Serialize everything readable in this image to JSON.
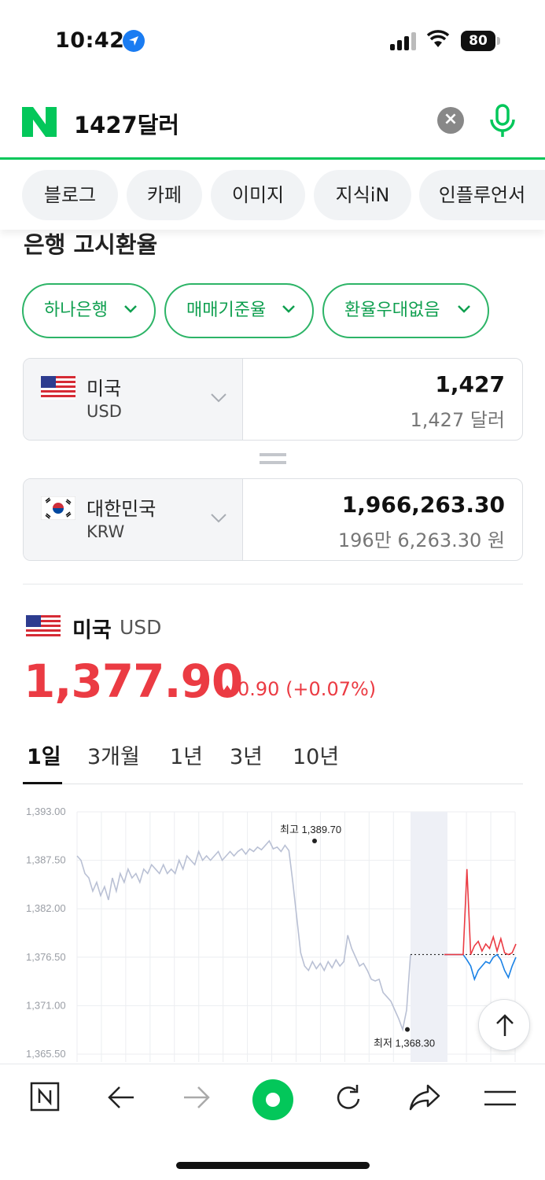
{
  "status": {
    "time": "10:42",
    "battery": "80"
  },
  "search": {
    "query": "1427달러"
  },
  "tabs": [
    "블로그",
    "카페",
    "이미지",
    "지식iN",
    "인플루언서"
  ],
  "section": {
    "title": "은행 고시환율",
    "chips": [
      "하나은행",
      "매매기준율",
      "환율우대없음"
    ]
  },
  "converter": {
    "from": {
      "name": "미국",
      "code": "USD",
      "amount": "1,427",
      "amount_text": "1,427 달러"
    },
    "to": {
      "name": "대한민국",
      "code": "KRW",
      "amount": "1,966,263.30",
      "amount_text": "196만 6,263.30 원"
    }
  },
  "rate": {
    "name": "미국",
    "code": "USD",
    "price": "1,377.90",
    "change": "0.90 (+0.07%)",
    "up_color": "#eb3b43",
    "down_color": "#1a82e6"
  },
  "periods": [
    "1일",
    "3개월",
    "1년",
    "3년",
    "10년"
  ],
  "chart_data": {
    "type": "line",
    "ylabels": [
      "1,393.00",
      "1,387.50",
      "1,382.00",
      "1,376.50",
      "1,371.00",
      "1,365.50"
    ],
    "ylim": [
      1365.5,
      1393.0
    ],
    "high_label": "최고 1,389.70",
    "low_label": "최저 1,368.30",
    "high": 1389.7,
    "low": 1368.3,
    "reference": 1376.8,
    "series": [
      {
        "values": [
          1388.0,
          1387.5,
          1386.0,
          1385.5,
          1384.0,
          1385.0,
          1383.5,
          1384.5,
          1383.0,
          1385.5,
          1384.0,
          1386.0,
          1385.0,
          1386.5,
          1385.5,
          1386.0,
          1385.0,
          1386.5,
          1386.0,
          1387.0,
          1386.5,
          1386.0,
          1387.0,
          1386.0,
          1386.5,
          1386.0,
          1387.5,
          1386.5,
          1388.0,
          1387.5,
          1387.0,
          1388.5,
          1387.5,
          1388.0,
          1387.5,
          1388.0,
          1388.5,
          1387.5,
          1388.0,
          1388.5,
          1388.0,
          1388.5,
          1388.8,
          1388.2,
          1388.8,
          1388.5,
          1389.0,
          1388.7,
          1389.2,
          1389.7,
          1388.8,
          1389.0,
          1388.5,
          1389.2,
          1388.6,
          1385.0,
          1381.0,
          1377.0,
          1375.5,
          1375.0,
          1376.0,
          1375.2,
          1375.8,
          1375.0,
          1376.0,
          1375.3,
          1376.2,
          1375.5,
          1376.0,
          1379.0,
          1377.5,
          1376.5,
          1375.5,
          1375.8,
          1375.0,
          1374.0,
          1373.8,
          1374.0,
          1372.5,
          1372.0,
          1371.5,
          1370.5,
          1369.5,
          1368.3,
          1370.5,
          1376.8
        ]
      },
      {
        "values": [
          1376.8,
          1376.8,
          1376.8,
          1376.8,
          1376.8,
          1376.8,
          1386.5,
          1376.8,
          1377.8,
          1378.3,
          1377.2,
          1378.0,
          1377.5,
          1378.8,
          1377.2,
          1378.6,
          1377.0,
          1376.8,
          1377.0,
          1378.0
        ]
      },
      {
        "values": [
          1376.8,
          1376.8,
          1376.8,
          1376.8,
          1376.8,
          1376.8,
          1376.2,
          1375.5,
          1374.0,
          1375.0,
          1375.5,
          1376.0,
          1375.8,
          1376.5,
          1376.8,
          1376.2,
          1375.0,
          1374.2,
          1375.5,
          1376.5
        ]
      }
    ]
  }
}
